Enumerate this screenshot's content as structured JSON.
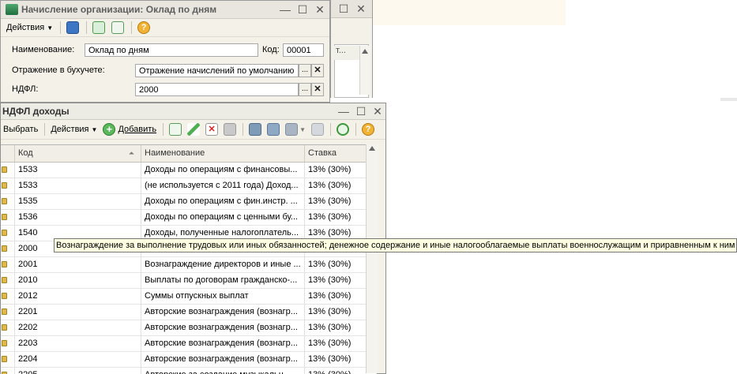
{
  "background": {
    "strip_color": "#fdf9ee"
  },
  "back_window": {
    "col_label": "т..."
  },
  "accrual_window": {
    "title": "Начисление организации: Оклад по дням",
    "toolbar": {
      "actions_label": "Действия"
    },
    "fields": {
      "name_label": "Наименование:",
      "name_value": "Оклад по дням",
      "code_label": "Код:",
      "code_value": "00001",
      "accounting_label": "Отражение в бухучете:",
      "accounting_value": "Отражение начислений по умолчанию",
      "ndfl_label": "НДФЛ:",
      "ndfl_value": "2000"
    }
  },
  "ndfl_window": {
    "title": "НДФЛ доходы",
    "toolbar": {
      "select_label": "Выбрать",
      "actions_label": "Действия",
      "add_label": "Добавить"
    },
    "columns": [
      "Код",
      "Наименование",
      "Ставка"
    ],
    "rows": [
      {
        "code": "1533",
        "name": "Доходы по операциям с финансовы...",
        "rate": "13% (30%)"
      },
      {
        "code": "1533",
        "name": "(не используется с 2011 года) Доход...",
        "rate": "13% (30%)"
      },
      {
        "code": "1535",
        "name": "Доходы по операциям с фин.инстр. ...",
        "rate": "13% (30%)"
      },
      {
        "code": "1536",
        "name": "Доходы по операциям с ценными бу...",
        "rate": "13% (30%)"
      },
      {
        "code": "1540",
        "name": "Доходы, полученные налогоплатель...",
        "rate": "13% (30%)"
      },
      {
        "code": "2000",
        "name": "",
        "rate": ""
      },
      {
        "code": "2001",
        "name": "Вознаграждение директоров и иные ...",
        "rate": "13% (30%)"
      },
      {
        "code": "2010",
        "name": "Выплаты по договорам гражданско-...",
        "rate": "13% (30%)"
      },
      {
        "code": "2012",
        "name": "Суммы отпускных выплат",
        "rate": "13% (30%)"
      },
      {
        "code": "2201",
        "name": "Авторские вознаграждения (вознагр...",
        "rate": "13% (30%)"
      },
      {
        "code": "2202",
        "name": "Авторские вознаграждения (вознагр...",
        "rate": "13% (30%)"
      },
      {
        "code": "2203",
        "name": "Авторские вознаграждения (вознагр...",
        "rate": "13% (30%)"
      },
      {
        "code": "2204",
        "name": "Авторские вознаграждения (вознагр...",
        "rate": "13% (30%)"
      },
      {
        "code": "2205",
        "name": "Авторские за создание музыкальн...",
        "rate": "13% (30%)"
      }
    ],
    "tooltip": "Вознаграждение за выполнение трудовых или иных обязанностей; денежное содержание и иные налогооблагаемые выплаты военнослужащим и приравненным к ним"
  }
}
